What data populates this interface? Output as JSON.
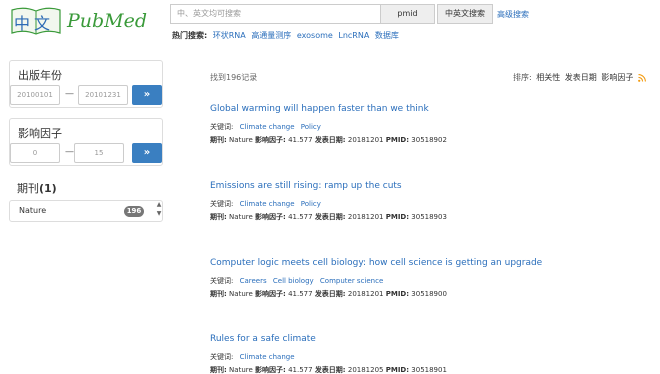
{
  "logo": {
    "cn": "中文",
    "brand": "PubMed"
  },
  "search": {
    "placeholder": "中、英文均可搜索",
    "pmid_label": "pmid",
    "cnen_label": "中英文搜索",
    "advanced_label": "高级搜索"
  },
  "hot": {
    "label": "热门搜索:",
    "tags": [
      "环状RNA",
      "高通量测序",
      "exosome",
      "LncRNA",
      "数据库"
    ]
  },
  "year_filter": {
    "title": "出版年份",
    "from": "20100101",
    "to": "20101231",
    "dash": "—",
    "go": "»"
  },
  "if_filter": {
    "title": "影响因子",
    "from": "0",
    "to": "15",
    "dash": "—",
    "go": "»"
  },
  "journal_filter": {
    "title": "期刊",
    "count": "(1)",
    "items": [
      {
        "name": "Nature",
        "count": "196"
      }
    ]
  },
  "results": {
    "count_text": "找到196记录",
    "sort_label": "排序:",
    "sort_options": [
      "相关性",
      "发表日期",
      "影响因子"
    ],
    "kw_label": "关键词:",
    "journal_label": "期刊:",
    "if_label": "影响因子:",
    "date_label": "发表日期:",
    "pmid_label": "PMID:",
    "items": [
      {
        "title": "Global warming will happen faster than we think",
        "keywords": [
          "Climate change",
          "Policy"
        ],
        "journal": "Nature",
        "if": "41.577",
        "date": "20181201",
        "pmid": "30518902"
      },
      {
        "title": "Emissions are still rising: ramp up the cuts",
        "keywords": [
          "Climate change",
          "Policy"
        ],
        "journal": "Nature",
        "if": "41.577",
        "date": "20181201",
        "pmid": "30518903"
      },
      {
        "title": "Computer logic meets cell biology: how cell science is getting an upgrade",
        "keywords": [
          "Careers",
          "Cell biology",
          "Computer science"
        ],
        "journal": "Nature",
        "if": "41.577",
        "date": "20181201",
        "pmid": "30518900"
      },
      {
        "title": "Rules for a safe climate",
        "keywords": [
          "Climate change"
        ],
        "journal": "Nature",
        "if": "41.577",
        "date": "20181205",
        "pmid": "30518901"
      }
    ]
  },
  "colors": {
    "link": "#2a6ebb",
    "brand_green": "#3a9a3a",
    "button_blue": "#3a7fc1",
    "rss": "#f39c12"
  }
}
